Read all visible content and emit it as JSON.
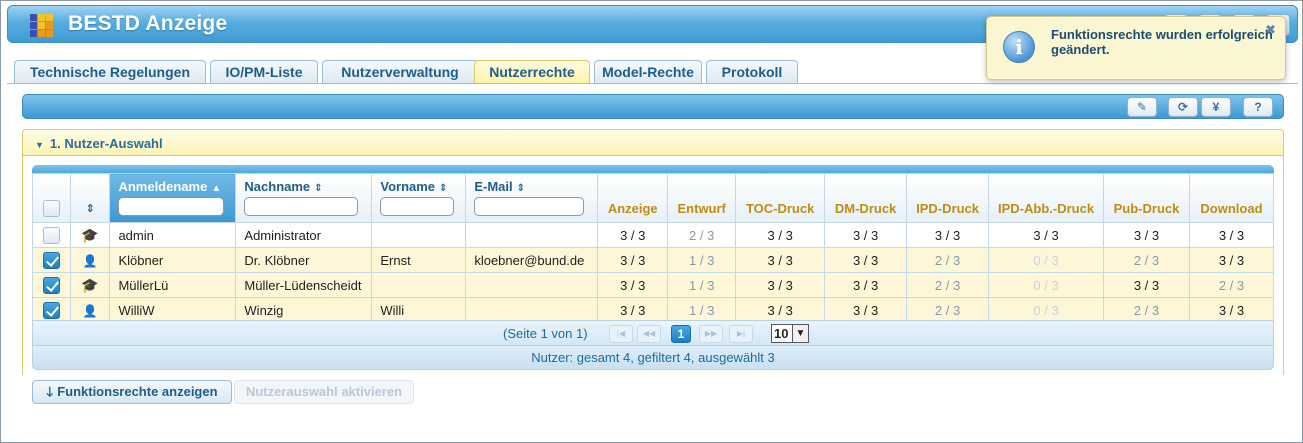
{
  "app": {
    "title": "BESTD Anzeige"
  },
  "header_buttons": [
    {
      "icon": "user-icon",
      "glyph": "👤"
    },
    {
      "icon": "help-icon",
      "glyph": "?"
    },
    {
      "icon": "settings-icon",
      "glyph": "⚙"
    },
    {
      "icon": "menu-icon",
      "glyph": "≡"
    }
  ],
  "tabs": [
    {
      "label": "Technische Regelungen",
      "active": false
    },
    {
      "label": "IO/PM-Liste",
      "active": false
    },
    {
      "label": "Nutzerverwaltung",
      "active": false
    },
    {
      "label": "Nutzerrechte",
      "active": true
    },
    {
      "label": "Model-Rechte",
      "active": false
    },
    {
      "label": "Protokoll",
      "active": false
    }
  ],
  "toolbar": [
    {
      "icon": "edit-icon",
      "glyph": "✎"
    },
    {
      "icon": "refresh-icon",
      "glyph": "⟳"
    },
    {
      "icon": "yen-icon",
      "glyph": "¥"
    },
    {
      "icon": "help-icon",
      "glyph": "?"
    }
  ],
  "section": {
    "title": "1. Nutzer-Auswahl"
  },
  "grid": {
    "columns": {
      "login": "Anmeldename",
      "lastname": "Nachname",
      "firstname": "Vorname",
      "email": "E-Mail",
      "perms": [
        "Anzeige",
        "Entwurf",
        "TOC-Druck",
        "DM-Druck",
        "IPD-Druck",
        "IPD-Abb.-Druck",
        "Pub-Druck",
        "Download"
      ]
    },
    "rows": [
      {
        "checked": false,
        "type": "admin",
        "login": "admin",
        "lastname": "Administrator",
        "firstname": "",
        "email": "",
        "perms": [
          "3 / 3",
          "2 / 3",
          "3 / 3",
          "3 / 3",
          "3 / 3",
          "3 / 3",
          "3 / 3",
          "3 / 3"
        ]
      },
      {
        "checked": true,
        "type": "user",
        "login": "Klöbner",
        "lastname": "Dr. Klöbner",
        "firstname": "Ernst",
        "email": "kloebner@bund.de",
        "perms": [
          "3 / 3",
          "1 / 3",
          "3 / 3",
          "3 / 3",
          "2 / 3",
          "0 / 3",
          "2 / 3",
          "3 / 3"
        ]
      },
      {
        "checked": true,
        "type": "admin",
        "login": "MüllerLü",
        "lastname": "Müller-Lüdenscheidt",
        "firstname": "",
        "email": "",
        "perms": [
          "3 / 3",
          "1 / 3",
          "3 / 3",
          "3 / 3",
          "2 / 3",
          "0 / 3",
          "3 / 3",
          "2 / 3"
        ]
      },
      {
        "checked": true,
        "type": "user",
        "login": "WilliW",
        "lastname": "Winzig",
        "firstname": "Willi",
        "email": "",
        "perms": [
          "3 / 3",
          "1 / 3",
          "3 / 3",
          "3 / 3",
          "2 / 3",
          "0 / 3",
          "2 / 3",
          "3 / 3"
        ]
      }
    ],
    "perm_styles": [
      [
        "",
        "dim",
        "",
        "",
        "",
        "",
        "",
        ""
      ],
      [
        "",
        "dim",
        "",
        "",
        "dim",
        "faint",
        "dim",
        ""
      ],
      [
        "",
        "dim",
        "",
        "",
        "dim",
        "faint",
        "",
        "dim"
      ],
      [
        "",
        "dim",
        "",
        "",
        "dim",
        "faint",
        "dim",
        ""
      ]
    ]
  },
  "pager": {
    "text": "(Seite 1 von 1)",
    "current_page": "1",
    "page_size": "10"
  },
  "summary": "Nutzer: gesamt 4, gefiltert 4, ausgewählt 3",
  "buttons": {
    "show": "Funktionsrechte anzeigen",
    "activate": "Nutzerauswahl aktivieren"
  },
  "toast": {
    "message": "Funktionsrechte wurden erfolgreich geändert."
  },
  "colors": {
    "accent": "#3d98d2",
    "perm_header": "#c08c12",
    "selected_row": "#fdf7d8"
  }
}
